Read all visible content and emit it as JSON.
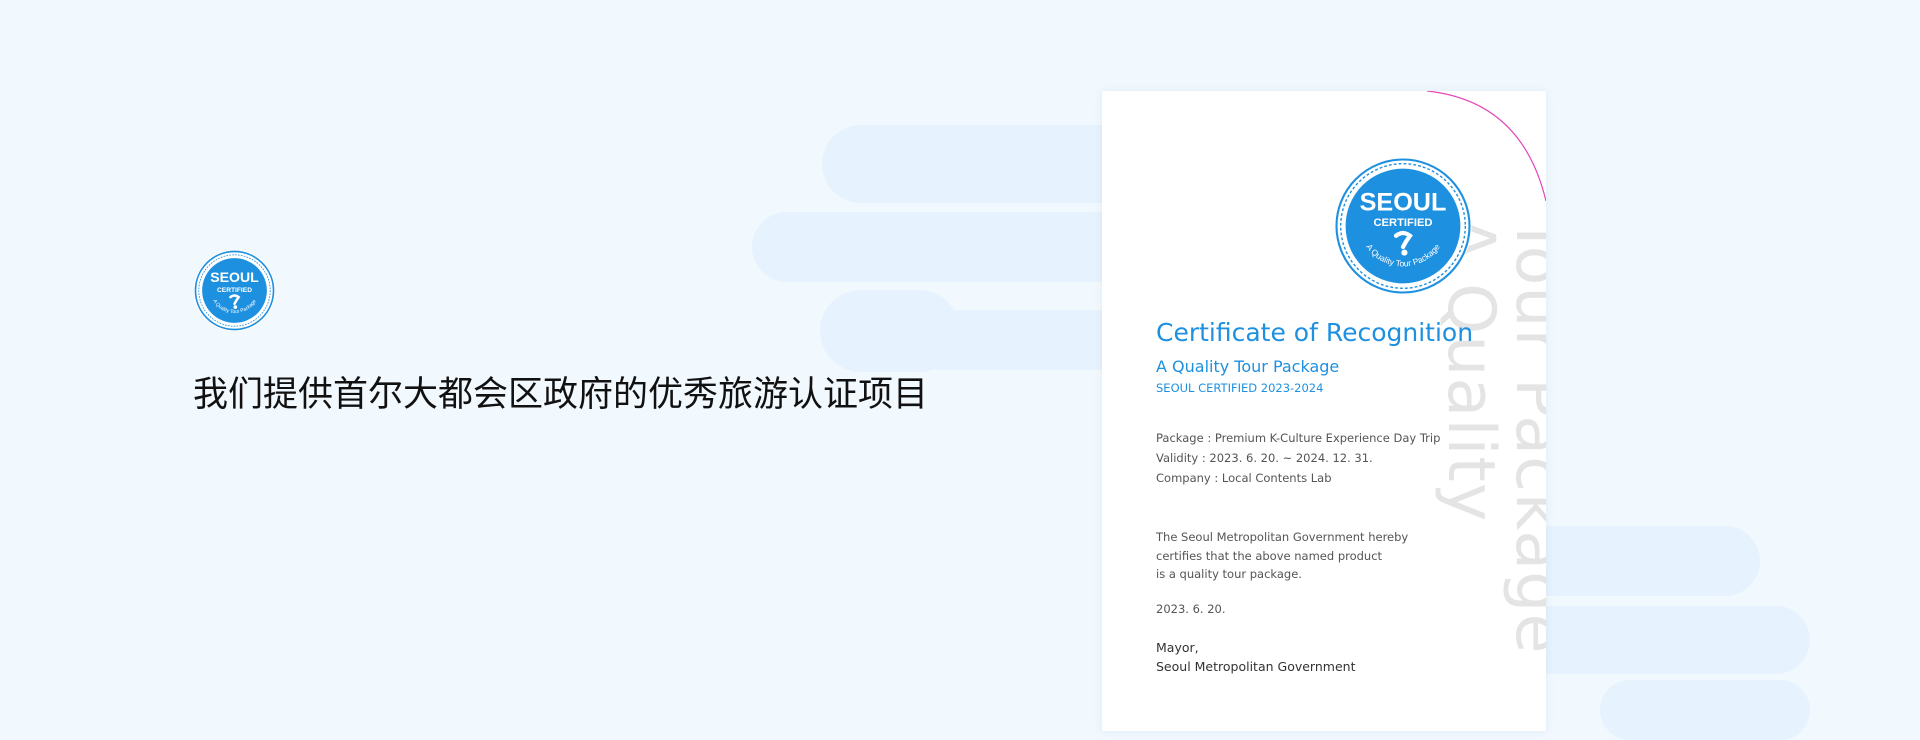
{
  "intro": {
    "heading": "我们提供首尔大都会区政府的优秀旅游认证项目"
  },
  "seal": {
    "line1": "SEOUL",
    "line2": "CERTIFIED",
    "ring_text": "A Quality Tour Package",
    "color": "#1e90e0"
  },
  "certificate": {
    "title": "Certificate of Recognition",
    "subtitle": "A Quality Tour Package",
    "year_line": "SEOUL CERTIFIED 2023-2024",
    "info": [
      {
        "label": "Package :",
        "value": "Premium K-Culture Experience Day Trip"
      },
      {
        "label": "Validity :",
        "value": "2023. 6. 20. ~ 2024. 12. 31."
      },
      {
        "label": "Company :",
        "value": "Local Contents Lab"
      }
    ],
    "statement": [
      "The Seoul Metropolitan Government hereby",
      "certifies that the above named product",
      "is a quality tour package."
    ],
    "date": "2023. 6. 20.",
    "signer_title": "Mayor,",
    "signer_org": "Seoul Metropolitan Government",
    "watermark_line1": "A Quality",
    "watermark_line2": "Tour Package"
  },
  "colors": {
    "accent": "#1e90e0",
    "arc": "#e545b8",
    "background": "#f1f8fe"
  }
}
